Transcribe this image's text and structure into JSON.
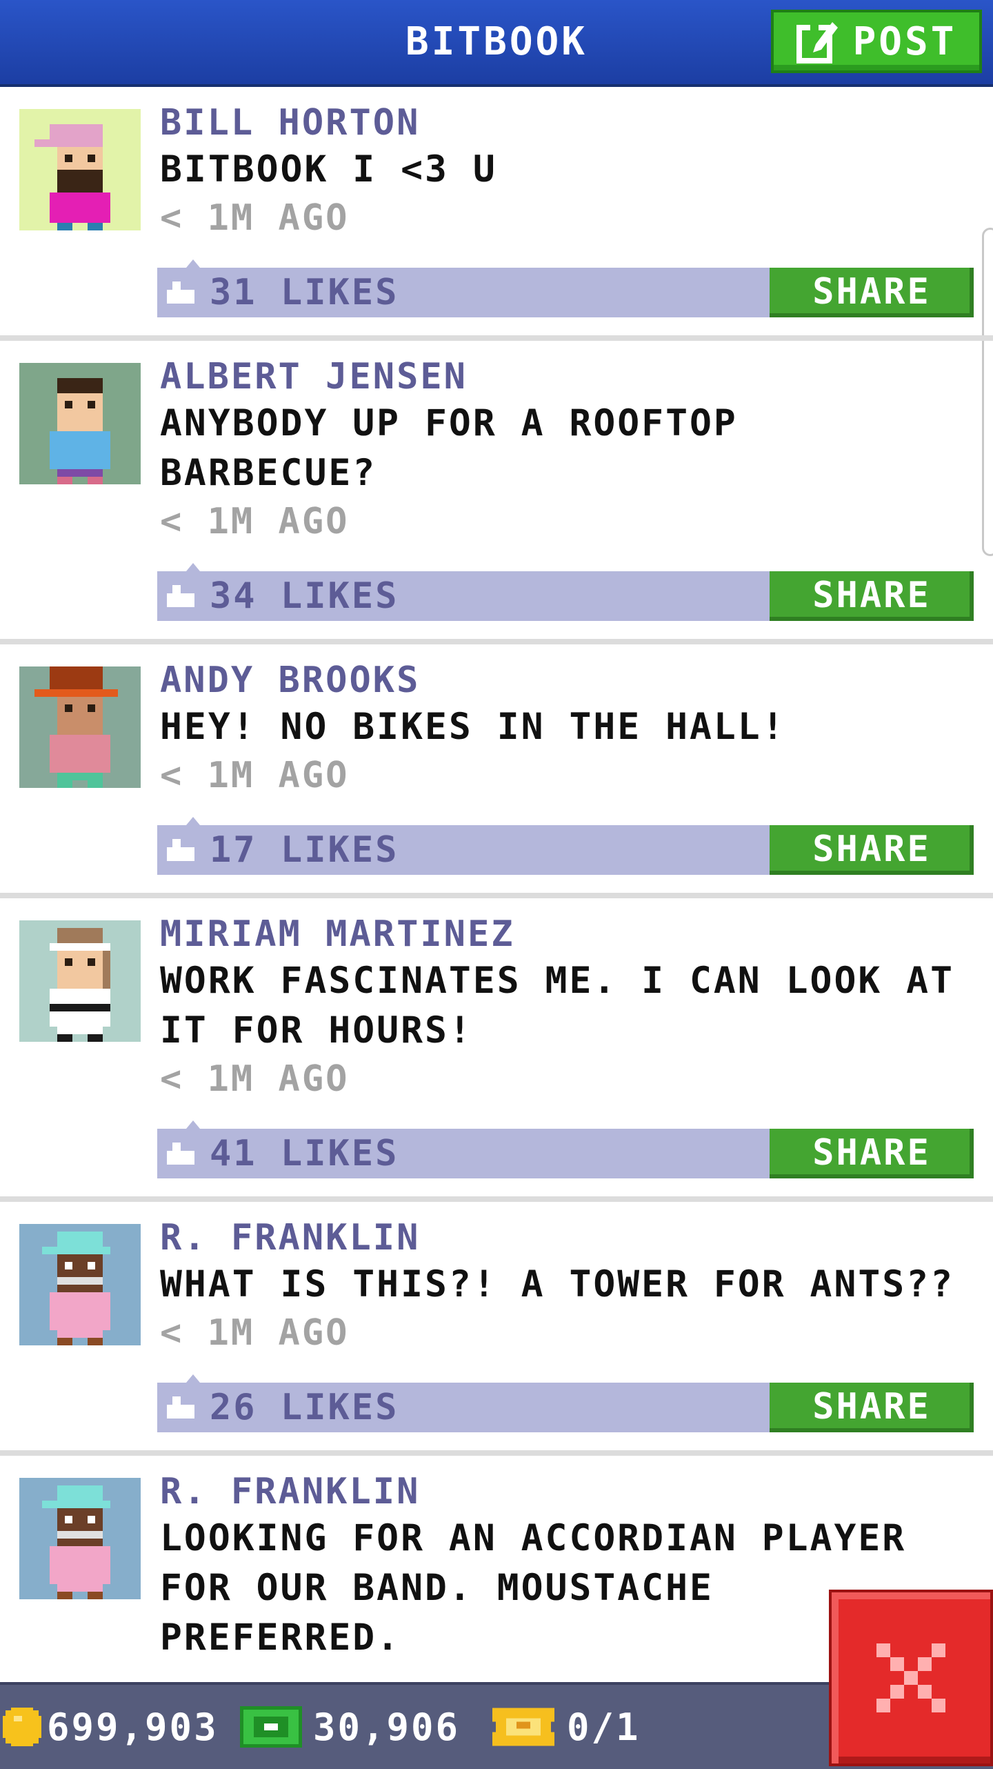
{
  "header": {
    "title": "BITBOOK",
    "post_label": "POST"
  },
  "posts": [
    {
      "author": "BILL HORTON",
      "message": "BITBOOK I <3 U",
      "time": "< 1M AGO",
      "likes": "31 LIKES",
      "share": "SHARE",
      "avatar_bg": "#e2f3a9"
    },
    {
      "author": "ALBERT JENSEN",
      "message": "ANYBODY UP FOR A ROOFTOP BARBECUE?",
      "time": "< 1M AGO",
      "likes": "34 LIKES",
      "share": "SHARE",
      "avatar_bg": "#7fa68a"
    },
    {
      "author": "ANDY BROOKS",
      "message": "HEY! NO BIKES IN THE HALL!",
      "time": "< 1M AGO",
      "likes": "17 LIKES",
      "share": "SHARE",
      "avatar_bg": "#86a899"
    },
    {
      "author": "MIRIAM MARTINEZ",
      "message": "WORK FASCINATES ME. I CAN LOOK AT IT FOR HOURS!",
      "time": "< 1M AGO",
      "likes": "41 LIKES",
      "share": "SHARE",
      "avatar_bg": "#b0d1c9"
    },
    {
      "author": "R. FRANKLIN",
      "message": "WHAT IS THIS?! A TOWER FOR ANTS??",
      "time": "< 1M AGO",
      "likes": "26 LIKES",
      "share": "SHARE",
      "avatar_bg": "#86aecb"
    },
    {
      "author": "R. FRANKLIN",
      "message": "LOOKING FOR AN ACCORDIAN PLAYER FOR OUR BAND. MOUSTACHE PREFERRED.",
      "time": "",
      "likes": "",
      "share": "",
      "avatar_bg": "#86aecb"
    }
  ],
  "status_bar": {
    "coins": "699,903",
    "bux": "30,906",
    "tickets": "0/1"
  },
  "colors": {
    "header_blue": "#1f45b0",
    "post_green": "#3fbe2b",
    "likes_bar": "#b4b7db",
    "share_green": "#44a531",
    "close_red": "#e42a2a",
    "author_purple": "#5d5c96"
  },
  "icons": {
    "post": "edit-icon",
    "like": "thumbs-up-icon",
    "coin": "coin-icon",
    "bux": "bux-icon",
    "ticket": "ticket-icon",
    "close": "close-icon"
  }
}
